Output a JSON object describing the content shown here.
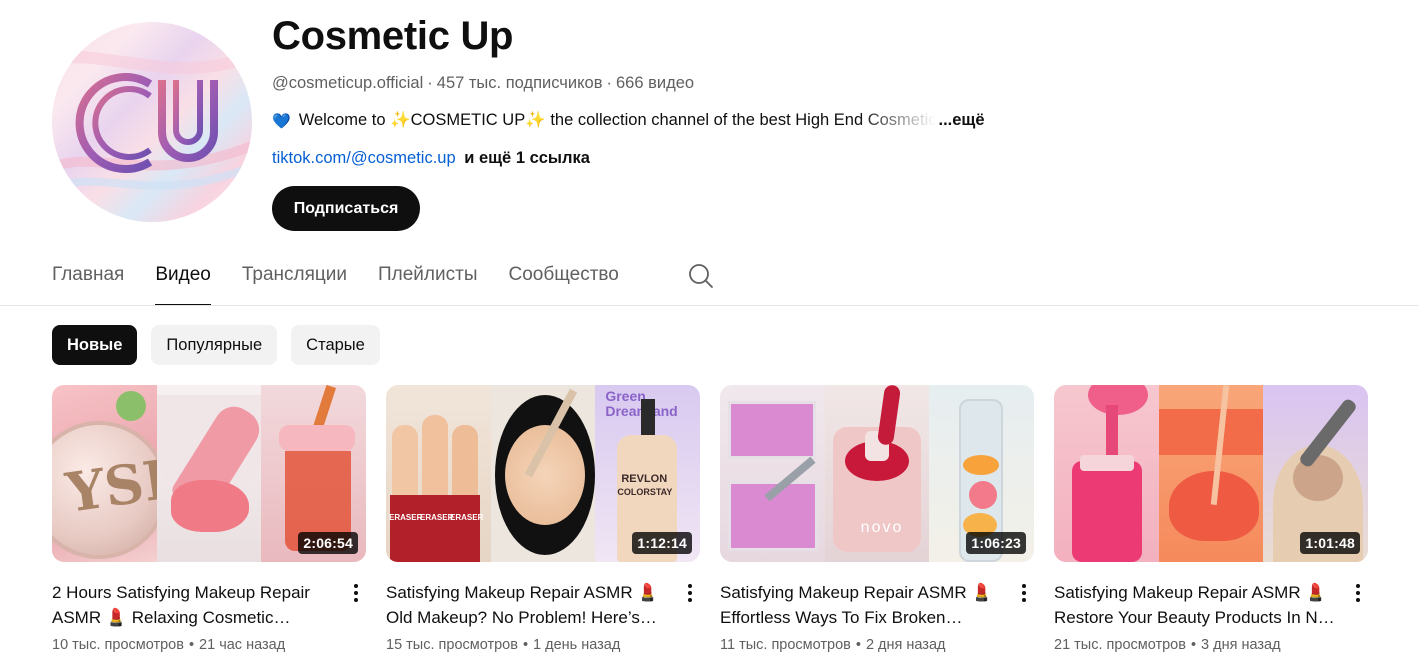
{
  "channel": {
    "name": "Cosmetic Up",
    "handle": "@cosmeticup.official",
    "subscribers": "457 тыс. подписчиков",
    "videos_count": "666 видео",
    "meta_separator": "·",
    "description": "Welcome to ✨COSMETIC UP✨ the collection channel of the best High End Cosmetic",
    "description_icon": "blue-heart-icon",
    "more_label": "...ещё",
    "link_text": "tiktok.com/@cosmetic.up",
    "extra_links": "и ещё 1 ссылка",
    "subscribe_label": "Подписаться",
    "avatar_logo": "CU"
  },
  "tabs": [
    {
      "label": "Главная",
      "active": false
    },
    {
      "label": "Видео",
      "active": true
    },
    {
      "label": "Трансляции",
      "active": false
    },
    {
      "label": "Плейлисты",
      "active": false
    },
    {
      "label": "Сообщество",
      "active": false
    }
  ],
  "tab_search_icon": "search-icon",
  "chips": [
    {
      "label": "Новые",
      "active": true
    },
    {
      "label": "Популярные",
      "active": false
    },
    {
      "label": "Старые",
      "active": false
    }
  ],
  "videos": [
    {
      "title": "2 Hours Satisfying Makeup Repair ASMR 💄 Relaxing Cosmetic Restorations",
      "views": "10 тыс. просмотров",
      "age": "21 час назад",
      "duration": "2:06:54"
    },
    {
      "title": "Satisfying Makeup Repair ASMR 💄 Old Makeup? No Problem! Here’s How To Fix It",
      "views": "15 тыс. просмотров",
      "age": "1 день назад",
      "duration": "1:12:14"
    },
    {
      "title": "Satisfying Makeup Repair ASMR 💄 Effortless Ways To Fix Broken Cosmetics",
      "views": "11 тыс. просмотров",
      "age": "2 дня назад",
      "duration": "1:06:23"
    },
    {
      "title": "Satisfying Makeup Repair ASMR 💄 Restore Your Beauty Products In No Time",
      "views": "21 тыс. просмотров",
      "age": "3 дня назад",
      "duration": "1:01:48"
    }
  ],
  "stats_separator": "•",
  "card_menu_icon": "more-vert-icon",
  "thumbnail_text": {
    "v2_brand_1": "ERASER",
    "v2_brand_2": "REVLON",
    "v2_brand_3": "COLORSTAY",
    "v2_brand_4": "Green Dreamland",
    "v3_brand": "novo"
  }
}
